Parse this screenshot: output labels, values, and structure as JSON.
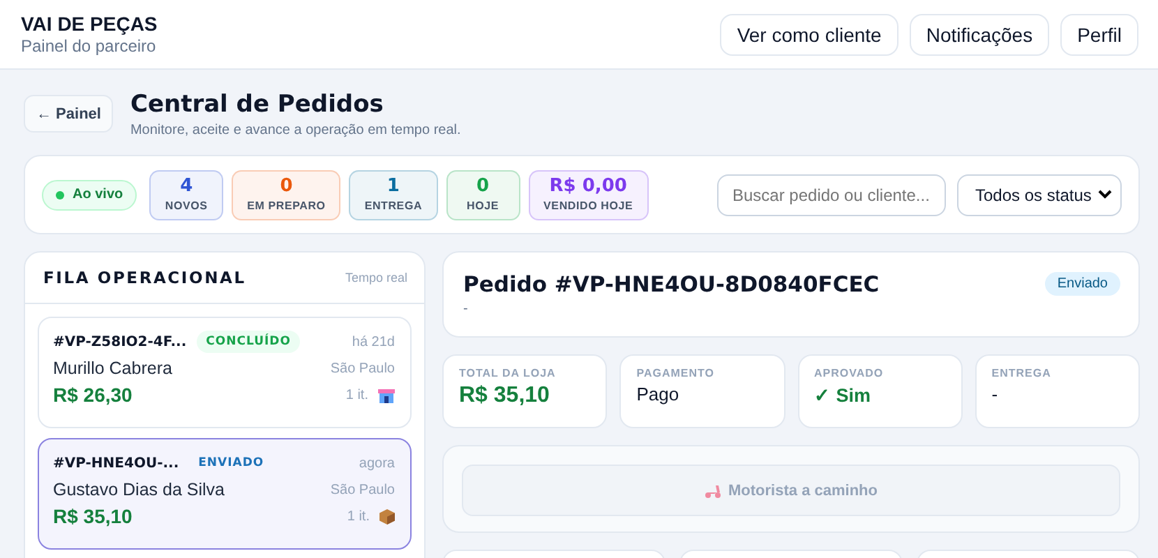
{
  "header": {
    "brand": "VAI DE PEÇAS",
    "subtitle": "Painel do parceiro",
    "buttons": [
      "Ver como cliente",
      "Notificações",
      "Perfil"
    ]
  },
  "page": {
    "back": "← Painel",
    "title": "Central de Pedidos",
    "subtitle": "Monitore, aceite e avance a operação em tempo real."
  },
  "live": {
    "label": "Ao vivo"
  },
  "stats": [
    {
      "value": "4",
      "label": "NOVOS",
      "color": "#2f55d4"
    },
    {
      "value": "0",
      "label": "EM PREPARO",
      "color": "#ea580c"
    },
    {
      "value": "1",
      "label": "ENTREGA",
      "color": "#0b6ea0"
    },
    {
      "value": "0",
      "label": "HOJE",
      "color": "#16a34a"
    },
    {
      "value": "R$ 0,00",
      "label": "VENDIDO HOJE",
      "color": "#7c3aed"
    }
  ],
  "search": {
    "placeholder": "Buscar pedido ou cliente..."
  },
  "status_filter": {
    "value": "Todos os status"
  },
  "queue": {
    "title": "FILA OPERACIONAL",
    "note": "Tempo real",
    "orders": [
      {
        "id": "#VP-Z58IO2-4F...",
        "status": "CONCLUÍDO",
        "kind": "done",
        "time": "há 21d",
        "customer": "Murillo Cabrera",
        "city": "São Paulo",
        "total": "R$ 26,30",
        "items": "1 it.",
        "selected": false
      },
      {
        "id": "#VP-HNE4OU-...",
        "status": "ENVIADO",
        "kind": "shipped",
        "time": "agora",
        "customer": "Gustavo Dias da Silva",
        "city": "São Paulo",
        "total": "R$ 35,10",
        "items": "1 it.",
        "selected": true
      }
    ]
  },
  "detail": {
    "title": "Pedido #VP-HNE4OU-8D0840FCEC",
    "subtitle": "-",
    "status": "Enviado",
    "facts": [
      {
        "label": "TOTAL DA LOJA",
        "value": "R$ 35,10",
        "kind": "money"
      },
      {
        "label": "PAGAMENTO",
        "value": "Pago",
        "kind": "plain"
      },
      {
        "label": "APROVADO",
        "value": "✓ Sim",
        "kind": "ok"
      },
      {
        "label": "ENTREGA",
        "value": "-",
        "kind": "plain"
      }
    ],
    "action": {
      "label": "Motorista a caminho",
      "disabled": true
    }
  }
}
